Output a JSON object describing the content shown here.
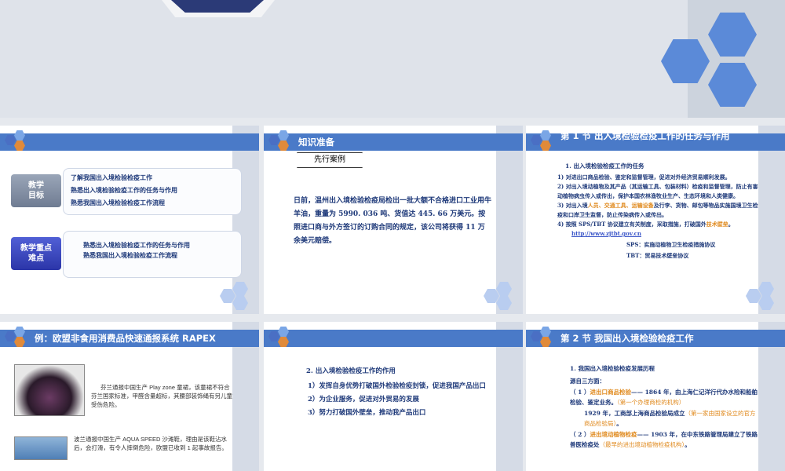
{
  "slides": {
    "s1": {
      "goal_label": "教学\n目标",
      "goal_items": [
        "了解我国出入境检验检疫工作",
        "熟悉出入境检验检疫工作的任务与作用",
        "熟悉我国出入境检验检疫工作流程"
      ],
      "key_label": "教学重点\n难点",
      "key_items": [
        "熟悉出入境检验检疫工作的任务与作用",
        "熟悉我国出入境检验检疫工作流程"
      ]
    },
    "s2": {
      "title": "知识准备",
      "case_tag": "先行案例",
      "case_text": "日前，温州出入境检验检疫局检出一批大额不合格进口工业用牛羊油，重量为 5990. 036 吨、货值达 445. 66 万美元。按照进口商与外方签订的订购合同的规定，该公司将获得 11 万余美元赔偿。"
    },
    "s3": {
      "title": "第 1 节  出入境检验检疫工作的任务与作用",
      "heading": "1.  出入境检验检疫工作的任务",
      "p1": "1) 对进出口商品检验、鉴定和监督管理，促进对外经济贸易顺利发展。",
      "p1_hl": "商品",
      "p2": "2) 对出入境动植物及其产品（其运输工具、包装材料）检疫和监督管理，防止有害动植物病虫传入或传出，保护本国农林渔牧业生产、生态环境和人类健康。",
      "p2_hl": "动植物及其产品",
      "p3_a": "3) 对出入境",
      "p3_hl1": "人员、交通工具、运输设备",
      "p3_b": "及行李、货物、邮包等物品实施国境卫生检疫和口岸卫生监督，防止传染病传入或传出。",
      "p4_a": "4) 按照 SPS/TBT 协议建立有关制度，采取措施，打破国外",
      "p4_hl": "技术壁垒",
      "p4_b": "。",
      "link": "http://www.zjtbt.gov.cn",
      "sps": "SPS：实施动植物卫生检疫措施协议",
      "tbt": "TBT：贸易技术壁垒协议"
    },
    "s4": {
      "title": "例：欧盟非食用消费品快速通报系统 RAPEX",
      "item1": "芬兰通报中国生产 Play zone 童裙，该童裙不符合芬兰国家标准，甲醛含量超标，其腰部装饰绳有另儿童受伤危险。",
      "item2": "波兰通报中国生产 AQUA SPEED  沙滩鞋，理由是该鞋沾水后，会打滑，有令人摔倒危险，欧盟已收到 1 起事故报告。"
    },
    "s5": {
      "heading": "2.  出入境检验检疫工作的作用",
      "items": [
        "1）发挥自身优势打破国外检验检疫封锁，促进我国产品出口",
        "2）为企业服务，促进对外贸易的发展",
        "3）努力打破国外壁垒，推动我产品出口"
      ]
    },
    "s6": {
      "title": "第 2 节  我国出入境检验检疫工作",
      "heading": "1.  我国出入境检验检疫发展历程",
      "sub": "源自三方面：",
      "i1_a": "（ 1 ）",
      "i1_hl": "进出口商品检验",
      "i1_b": "—— 1864 年，由上海仁记洋行代办水险和船舶检验、鉴定业务。",
      "i1_c": "（第一个办理商检的机构）",
      "i1_d": "1929 年，工商部上海商品检验局成立",
      "i1_e": "（第一家由国家设立的官方商品检验局）",
      "i1_f": "。",
      "i2_a": "（ 2 ）",
      "i2_hl": "进出境动植物检疫",
      "i2_b": "—— 1903 年，在中东铁路管理局建立了铁路兽医检疫处",
      "i2_c": "（最早的进出境动植物检疫机构）",
      "i2_d": "。"
    }
  }
}
